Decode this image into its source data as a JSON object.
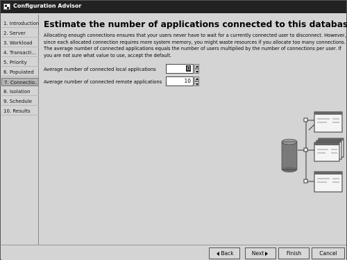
{
  "window": {
    "title": "Configuration Advisor"
  },
  "sidebar": {
    "items": [
      {
        "label": "1. Introduction"
      },
      {
        "label": "2. Server"
      },
      {
        "label": "3. Workload"
      },
      {
        "label": "4. Transacti..."
      },
      {
        "label": "5. Priority"
      },
      {
        "label": "6. Populated"
      },
      {
        "label": "7. Connectio...",
        "selected": true
      },
      {
        "label": "8. Isolation"
      },
      {
        "label": "9. Schedule"
      },
      {
        "label": "10. Results"
      }
    ]
  },
  "main": {
    "heading": "Estimate the number of applications connected to this database.",
    "description": "Allocating enough connections ensures that your users never have to wait for a currently connected user to disconnect. However, since each allocated connection requires more system memory, you might waste resources if you allocate too many connections. The average number of connected applications equals the number of users multiplied by the number of connections per user. If you are not sure what value to use, accept the default.",
    "fields": {
      "local_label": "Average number of connected local applications",
      "local_value": "0",
      "remote_label": "Average number of connected remote applications",
      "remote_value": "10"
    }
  },
  "footer": {
    "back_label": "Back",
    "next_label": "Next",
    "finish_label": "Finish",
    "cancel_label": "Cancel"
  },
  "icons": {
    "window_icon": "app-window-icon",
    "database": "database-cylinder-icon",
    "application": "application-window-icon"
  }
}
